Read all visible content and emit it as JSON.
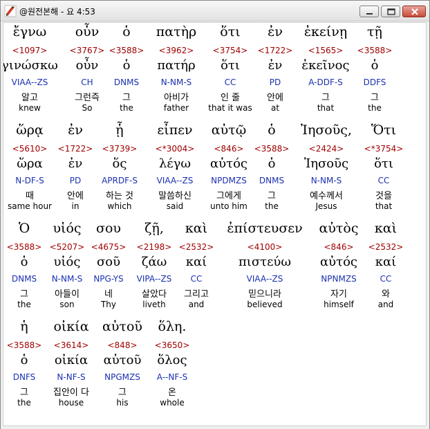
{
  "window": {
    "title": "@원전본해 - 요 4:53"
  },
  "rows": [
    {
      "words": [
        {
          "greek": "ἔγνω",
          "strong": "<1097>",
          "lemma": "γινώσκω",
          "parse": "VIAA--ZS",
          "korean": "알고",
          "english": "knew"
        },
        {
          "greek": "οὖν",
          "strong": "<3767>",
          "lemma": "οὖν",
          "parse": "CH",
          "korean": "그런즉",
          "english": "So"
        },
        {
          "greek": "ὁ",
          "strong": "<3588>",
          "lemma": "ὁ",
          "parse": "DNMS",
          "korean": "그",
          "english": "the"
        },
        {
          "greek": "πατὴρ",
          "strong": "<3962>",
          "lemma": "πατήρ",
          "parse": "N-NM-S",
          "korean": "아비가",
          "english": "father"
        },
        {
          "greek": "ὅτι",
          "strong": "<3754>",
          "lemma": "ὅτι",
          "parse": "CC",
          "korean": "인 줄",
          "english": "that it was"
        },
        {
          "greek": "ἐν",
          "strong": "<1722>",
          "lemma": "ἐν",
          "parse": "PD",
          "korean": "안에",
          "english": "at"
        },
        {
          "greek": "ἐκείνῃ",
          "strong": "<1565>",
          "lemma": "ἐκεῖνος",
          "parse": "A-DDF-S",
          "korean": "그",
          "english": "that"
        },
        {
          "greek": "τῇ",
          "strong": "<3588>",
          "lemma": "ὁ",
          "parse": "DDFS",
          "korean": "그",
          "english": "the"
        }
      ]
    },
    {
      "words": [
        {
          "greek": "ὥρᾳ",
          "strong": "<5610>",
          "lemma": "ὥρα",
          "parse": "N-DF-S",
          "korean": "때",
          "english": "same hour"
        },
        {
          "greek": "ἐν",
          "strong": "<1722>",
          "lemma": "ἐν",
          "parse": "PD",
          "korean": "안에",
          "english": "in"
        },
        {
          "greek": "ᾗ",
          "strong": "<3739>",
          "lemma": "ὅς",
          "parse": "APRDF-S",
          "korean": "하는 것",
          "english": "which"
        },
        {
          "greek": "εἶπεν",
          "strong": "<*3004>",
          "lemma": "λέγω",
          "parse": "VIAA--ZS",
          "korean": "말씀하신",
          "english": "said"
        },
        {
          "greek": "αὐτῷ",
          "strong": "<846>",
          "lemma": "αὐτός",
          "parse": "NPDMZS",
          "korean": "그에게",
          "english": "unto him"
        },
        {
          "greek": "ὁ",
          "strong": "<3588>",
          "lemma": "ὁ",
          "parse": "DNMS",
          "korean": "그",
          "english": "the"
        },
        {
          "greek": "Ἰησοῦς,",
          "strong": "<2424>",
          "lemma": "Ἰησοῦς",
          "parse": "N-NM-S",
          "korean": "예수께서",
          "english": "Jesus"
        },
        {
          "greek": "Ὅτι",
          "strong": "<*3754>",
          "lemma": "ὅτι",
          "parse": "CC",
          "korean": "것을",
          "english": "that"
        }
      ]
    },
    {
      "words": [
        {
          "greek": "Ὁ",
          "strong": "<3588>",
          "lemma": "ὁ",
          "parse": "DNMS",
          "korean": "그",
          "english": "the"
        },
        {
          "greek": "υἱός",
          "strong": "<5207>",
          "lemma": "υἱός",
          "parse": "N-NM-S",
          "korean": "아들이",
          "english": "son"
        },
        {
          "greek": "σου",
          "strong": "<4675>",
          "lemma": "σοῦ",
          "parse": "NPG-YS",
          "korean": "네",
          "english": "Thy"
        },
        {
          "greek": "ζῇ,",
          "strong": "<2198>",
          "lemma": "ζάω",
          "parse": "VIPA--ZS",
          "korean": "살았다",
          "english": "liveth"
        },
        {
          "greek": "καὶ",
          "strong": "<2532>",
          "lemma": "καί",
          "parse": "CC",
          "korean": "그리고",
          "english": "and"
        },
        {
          "greek": "ἐπίστευσεν",
          "strong": "<4100>",
          "lemma": "πιστεύω",
          "parse": "VIAA--ZS",
          "korean": "믿으니라",
          "english": "believed"
        },
        {
          "greek": "αὐτὸς",
          "strong": "<846>",
          "lemma": "αὐτός",
          "parse": "NPNMZS",
          "korean": "자기",
          "english": "himself"
        },
        {
          "greek": "καὶ",
          "strong": "<2532>",
          "lemma": "καί",
          "parse": "CC",
          "korean": "와",
          "english": "and"
        }
      ]
    },
    {
      "words": [
        {
          "greek": "ἡ",
          "strong": "<3588>",
          "lemma": "ὁ",
          "parse": "DNFS",
          "korean": "그",
          "english": "the"
        },
        {
          "greek": "οἰκία",
          "strong": "<3614>",
          "lemma": "οἰκία",
          "parse": "N-NF-S",
          "korean": "집안이 다",
          "english": "house"
        },
        {
          "greek": "αὐτοῦ",
          "strong": "<848>",
          "lemma": "αὐτοῦ",
          "parse": "NPGMZS",
          "korean": "그",
          "english": "his"
        },
        {
          "greek": "ὅλη.",
          "strong": "<3650>",
          "lemma": "ὅλος",
          "parse": "A--NF-S",
          "korean": "온",
          "english": "whole"
        }
      ]
    }
  ]
}
